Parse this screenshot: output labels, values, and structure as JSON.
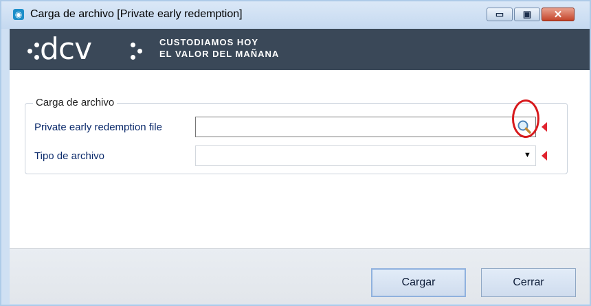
{
  "window": {
    "title": "Carga de archivo [Private early redemption]",
    "controls": {
      "minimize_glyph": "▭",
      "maximize_glyph": "▣",
      "close_glyph": "✕"
    }
  },
  "banner": {
    "logo_text": "dcv",
    "tagline_line1": "CUSTODIAMOS HOY",
    "tagline_line2": "EL VALOR DEL MAÑANA",
    "background_color": "#3a4858"
  },
  "form": {
    "group_title": "Carga de archivo",
    "fields": [
      {
        "label": "Private early redemption file",
        "value": "",
        "type": "file",
        "required": true,
        "action_icon": "magnifier-icon"
      },
      {
        "label": "Tipo de archivo",
        "value": "",
        "type": "select",
        "required": true
      }
    ],
    "highlight_color": "#d7191c",
    "required_marker_color": "#e0242f"
  },
  "footer": {
    "upload_label": "Cargar",
    "close_label": "Cerrar"
  }
}
